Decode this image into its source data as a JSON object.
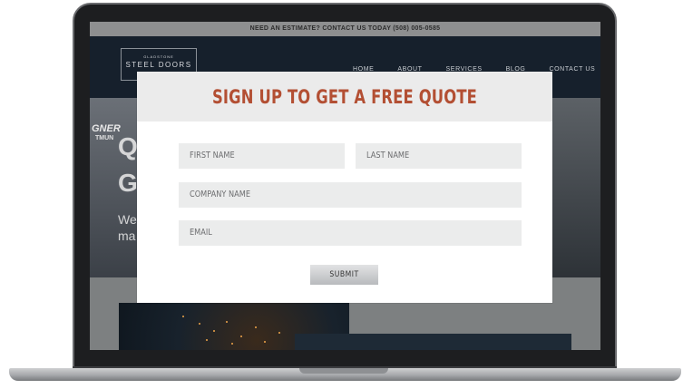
{
  "site": {
    "topbar_text": "NEED AN ESTIMATE? CONTACT US TODAY (508) 005-0585",
    "logo_small": "GLADSTONE",
    "logo_main": "STEEL DOORS",
    "nav": [
      "HOME",
      "ABOUT",
      "SERVICES",
      "BLOG",
      "CONTACT US"
    ],
    "hero": {
      "gner": "GNER",
      "tmun": "TMUN",
      "line1": "Q",
      "line2": "G",
      "sub1": "We",
      "sub2": "ma"
    }
  },
  "modal": {
    "title": "SIGN UP TO GET A FREE QUOTE",
    "fields": {
      "first_name": "FIRST NAME",
      "last_name": "LAST NAME",
      "company_name": "COMPANY NAME",
      "email": "EMAIL"
    },
    "submit_label": "SUBMIT"
  },
  "colors": {
    "title_accent": "#b34f33",
    "field_bg": "#ebecec",
    "nav_bg": "#16202c"
  }
}
